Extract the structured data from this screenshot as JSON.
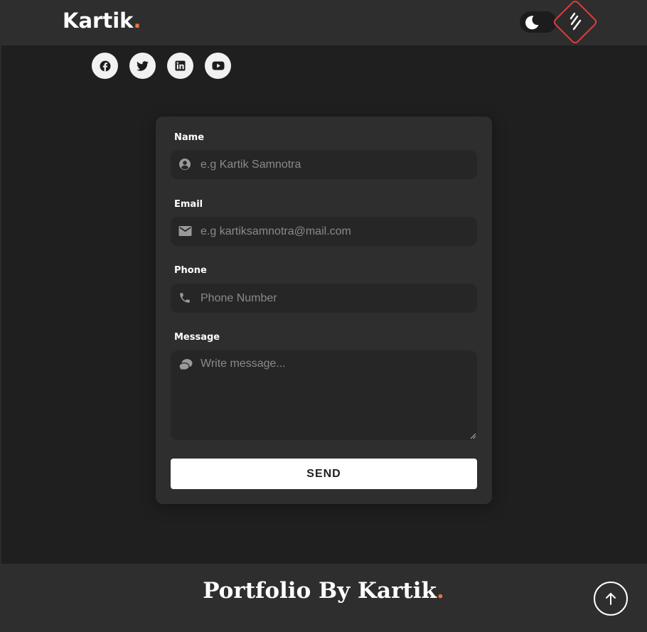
{
  "header": {
    "logo_text": "Kartik",
    "logo_dot": ".",
    "theme_toggle_icon": "moon-icon",
    "menu_icon": "menu-lines-icon"
  },
  "social": [
    {
      "name": "facebook",
      "icon": "facebook-icon"
    },
    {
      "name": "twitter",
      "icon": "twitter-icon"
    },
    {
      "name": "linkedin",
      "icon": "linkedin-icon"
    },
    {
      "name": "youtube",
      "icon": "youtube-icon"
    }
  ],
  "form": {
    "name_label": "Name",
    "name_placeholder": "e.g Kartik Samnotra",
    "email_label": "Email",
    "email_placeholder": "e.g kartiksamnotra@mail.com",
    "phone_label": "Phone",
    "phone_placeholder": "Phone Number",
    "message_label": "Message",
    "message_placeholder": "Write message...",
    "send_label": "SEND"
  },
  "footer": {
    "text": "Portfolio By Kartik",
    "dot": "."
  },
  "colors": {
    "accent": "#e8763a",
    "menu_border": "#e33b3b",
    "background": "#1f1f1f",
    "panel": "#2e2e2e"
  }
}
